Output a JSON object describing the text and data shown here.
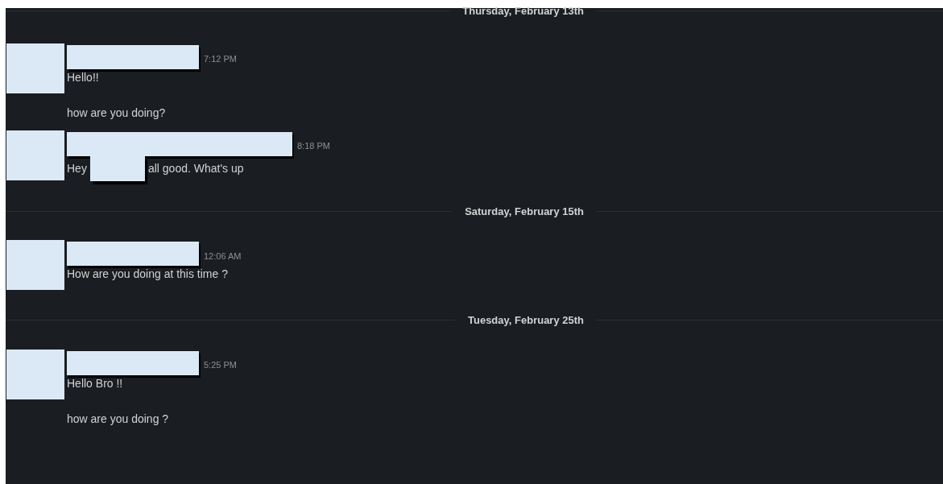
{
  "feed": [
    {
      "kind": "date",
      "label": "Thursday, February 13th"
    },
    {
      "kind": "message",
      "time": "7:12 PM",
      "lines": [
        [
          {
            "kind": "text",
            "text": "Hello!!"
          }
        ]
      ]
    },
    {
      "kind": "continuation",
      "lines": [
        [
          {
            "kind": "text",
            "text": "how are you doing?"
          }
        ]
      ]
    },
    {
      "kind": "message",
      "time": "8:18 PM",
      "lines": [
        [
          {
            "kind": "text",
            "text": "Hey"
          },
          {
            "kind": "redacted"
          },
          {
            "kind": "text",
            "text": "all good. What's up"
          }
        ]
      ]
    },
    {
      "kind": "date",
      "label": "Saturday, February 15th"
    },
    {
      "kind": "message",
      "time": "12:06 AM",
      "lines": [
        [
          {
            "kind": "text",
            "text": "How are you doing at this time ?"
          }
        ]
      ]
    },
    {
      "kind": "date",
      "label": "Tuesday, February 25th"
    },
    {
      "kind": "message",
      "time": "5:25 PM",
      "lines": [
        [
          {
            "kind": "text",
            "text": "Hello Bro !!"
          }
        ]
      ]
    },
    {
      "kind": "continuation",
      "lines": [
        [
          {
            "kind": "text",
            "text": "how are you doing ?"
          }
        ]
      ]
    }
  ]
}
